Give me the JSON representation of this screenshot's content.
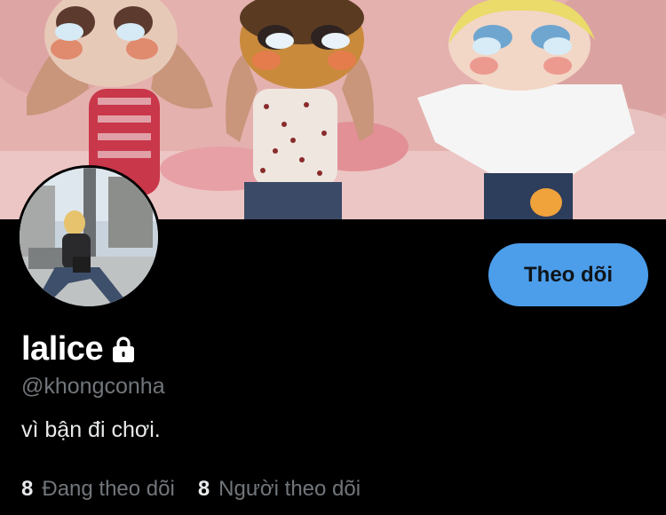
{
  "profile": {
    "display_name": "lalice",
    "handle": "@khongconha",
    "bio": "vì bận đi chơi.",
    "protected_icon": "lock-icon"
  },
  "actions": {
    "follow_label": "Theo dõi"
  },
  "stats": {
    "following_count": "8",
    "following_label": "Đang theo dõi",
    "followers_count": "8",
    "followers_label": "Người theo dõi"
  },
  "colors": {
    "background": "#000000",
    "follow_button": "#4c9eeb",
    "secondary_text": "#71767b",
    "primary_text": "#e7e9ea"
  }
}
